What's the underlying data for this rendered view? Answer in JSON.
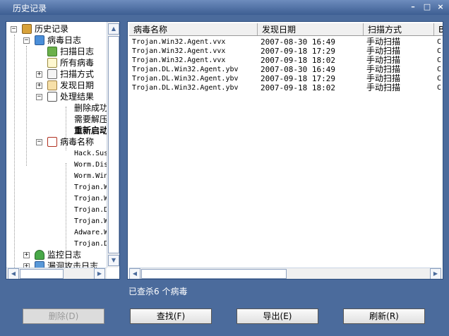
{
  "window": {
    "title": "历史记录",
    "controls": {
      "minimize": "–",
      "restore": "□",
      "close": "×"
    }
  },
  "tree": {
    "root": "历史记录",
    "virus_log": "病毒日志",
    "scan_log": "扫描日志",
    "all_viruses": "所有病毒",
    "scan_method": "扫描方式",
    "found_date": "发现日期",
    "result": "处理结果",
    "result_children": [
      "删除成功",
      "需要解压",
      "重新启动"
    ],
    "virus_name": "病毒名称",
    "name_children": [
      "Hack.Sus",
      "Worm.Dis",
      "Worm.Win",
      "Trojan.W",
      "Trojan.W",
      "Trojan.D",
      "Trojan.W",
      "Adware.W",
      "Trojan.D"
    ],
    "monitor_log": "监控日志",
    "vuln_log": "漏洞攻击日志"
  },
  "list": {
    "columns": [
      "病毒名称",
      "发现日期",
      "扫描方式",
      "B"
    ],
    "rows": [
      [
        "Trojan.Win32.Agent.vvx",
        "2007-08-30 16:49",
        "手动扫描",
        "C"
      ],
      [
        "Trojan.Win32.Agent.vvx",
        "2007-09-18 17:29",
        "手动扫描",
        "C"
      ],
      [
        "Trojan.Win32.Agent.vvx",
        "2007-09-18 18:02",
        "手动扫描",
        "C"
      ],
      [
        "Trojan.DL.Win32.Agent.ybv",
        "2007-08-30 16:49",
        "手动扫描",
        "C"
      ],
      [
        "Trojan.DL.Win32.Agent.ybv",
        "2007-09-18 17:29",
        "手动扫描",
        "C"
      ],
      [
        "Trojan.DL.Win32.Agent.ybv",
        "2007-09-18 18:02",
        "手动扫描",
        "C"
      ]
    ]
  },
  "status": "已查杀6 个病毒",
  "buttons": {
    "delete": "删除(D)",
    "find": "查找(F)",
    "export": "导出(E)",
    "refresh": "刷新(R)"
  },
  "colors": {
    "frame": "#4b6b9c",
    "title_gradient_top": "#6d8cbd",
    "title_gradient_bottom": "#3d5e92"
  }
}
